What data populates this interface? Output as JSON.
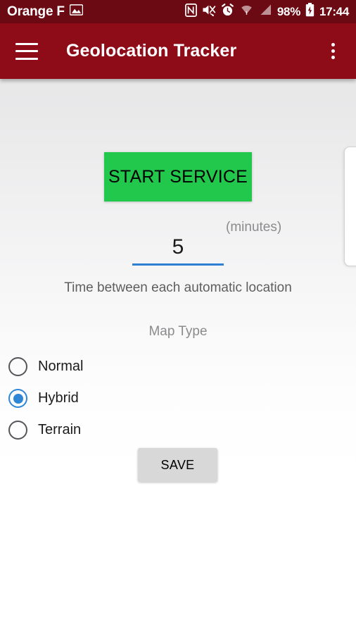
{
  "status_bar": {
    "carrier": "Orange F",
    "notification_icon": "image-icon",
    "icons": [
      "nfc-icon",
      "volume-mute-icon",
      "alarm-icon",
      "wifi-icon",
      "cellular-signal-icon"
    ],
    "battery_percent": "98%",
    "battery_icon": "battery-charging-icon",
    "time": "17:44",
    "background_color": "#6b0a13"
  },
  "app_bar": {
    "menu_icon": "hamburger-menu-icon",
    "title": "Geolocation Tracker",
    "overflow_icon": "more-vertical-icon",
    "background_color": "#8e0b18"
  },
  "main": {
    "start_button": {
      "label": "START SERVICE",
      "color": "#22c84c",
      "text_color": "#000000"
    },
    "interval": {
      "value": "5",
      "placeholder": "5",
      "unit_label": "(minutes)",
      "helper_text": "Time between each automatic location",
      "underline_color": "#2f7fd4"
    },
    "map_type": {
      "title": "Map Type",
      "selected": "Hybrid",
      "accent_color": "#2f86d4",
      "options": [
        {
          "label": "Normal",
          "checked": false
        },
        {
          "label": "Hybrid",
          "checked": true
        },
        {
          "label": "Terrain",
          "checked": false
        }
      ]
    },
    "save_button": {
      "label": "SAVE",
      "color": "#d8d8d8"
    }
  }
}
